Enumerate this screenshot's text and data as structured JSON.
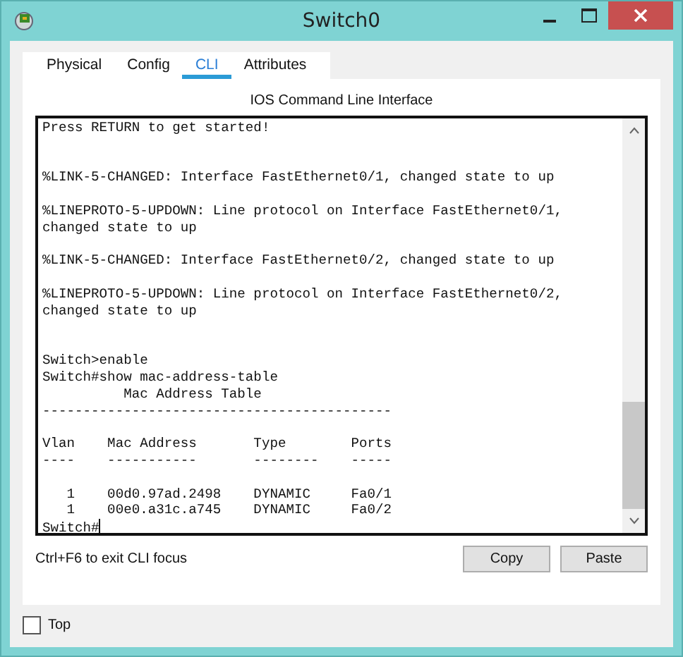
{
  "window": {
    "title": "Switch0"
  },
  "tabs": [
    {
      "label": "Physical",
      "selected": false
    },
    {
      "label": "Config",
      "selected": false
    },
    {
      "label": "CLI",
      "selected": true
    },
    {
      "label": "Attributes",
      "selected": false
    }
  ],
  "panel_title": "IOS Command Line Interface",
  "terminal": {
    "lines": [
      {
        "kind": "text",
        "text": "Press RETURN to get started!"
      },
      {
        "kind": "blank"
      },
      {
        "kind": "blank"
      },
      {
        "kind": "text",
        "text": "%LINK-5-CHANGED: Interface FastEthernet0/1, changed state to up"
      },
      {
        "kind": "blank"
      },
      {
        "kind": "text",
        "text": "%LINEPROTO-5-UPDOWN: Line protocol on Interface FastEthernet0/1,"
      },
      {
        "kind": "text",
        "text": "changed state to up"
      },
      {
        "kind": "blank"
      },
      {
        "kind": "text",
        "text": "%LINK-5-CHANGED: Interface FastEthernet0/2, changed state to up"
      },
      {
        "kind": "blank"
      },
      {
        "kind": "text",
        "text": "%LINEPROTO-5-UPDOWN: Line protocol on Interface FastEthernet0/2,"
      },
      {
        "kind": "text",
        "text": "changed state to up"
      },
      {
        "kind": "blank"
      },
      {
        "kind": "blank"
      },
      {
        "kind": "text",
        "text": "Switch>enable"
      },
      {
        "kind": "text",
        "text": "Switch#show mac-address-table"
      },
      {
        "kind": "text",
        "text": "          Mac Address Table"
      },
      {
        "kind": "text",
        "text": "-------------------------------------------"
      },
      {
        "kind": "blank"
      },
      {
        "kind": "text",
        "text": "Vlan    Mac Address       Type        Ports"
      },
      {
        "kind": "text",
        "text": "----    -----------       --------    -----"
      },
      {
        "kind": "blank"
      },
      {
        "kind": "text",
        "text": "   1    00d0.97ad.2498    DYNAMIC     Fa0/1"
      },
      {
        "kind": "text",
        "text": "   1    00e0.a31c.a745    DYNAMIC     Fa0/2"
      },
      {
        "kind": "prompt",
        "text": "Switch#"
      }
    ]
  },
  "hint": "Ctrl+F6 to exit CLI focus",
  "buttons": [
    "Copy",
    "Paste"
  ],
  "top_checkbox": {
    "label": "Top",
    "checked": false
  }
}
